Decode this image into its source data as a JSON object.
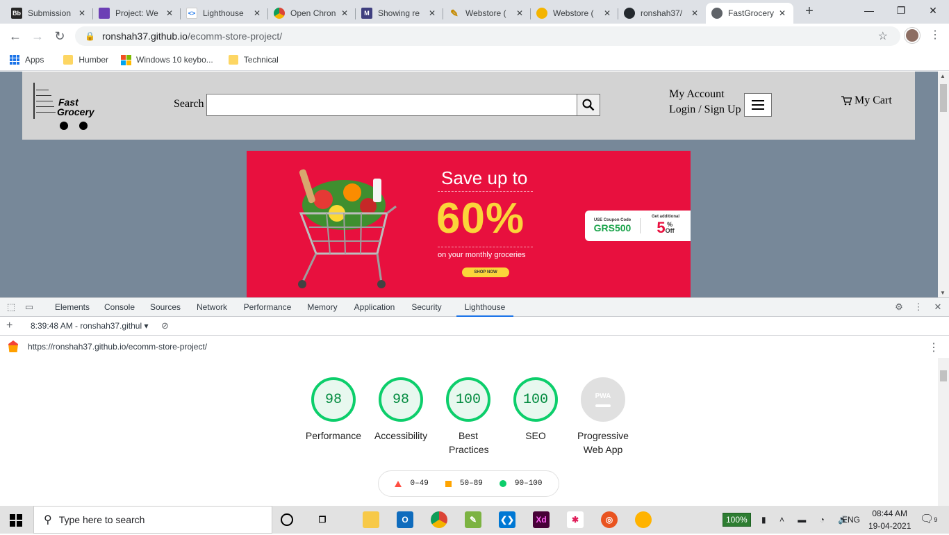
{
  "tabs": [
    {
      "title": "Submission",
      "icon": "blackboard-icon",
      "color": "#262626"
    },
    {
      "title": "Project: We",
      "icon": "project-icon",
      "color": "#6c3fb5"
    },
    {
      "title": "Lighthouse",
      "icon": "lighthouse-icon",
      "color": "#1a73e8"
    },
    {
      "title": "Open Chron",
      "icon": "chrome-icon",
      "color": "#4285f4"
    },
    {
      "title": "Showing re",
      "icon": "m-icon",
      "color": "#3f3f7f"
    },
    {
      "title": "Webstore (",
      "icon": "pencil-icon",
      "color": "#c58a00"
    },
    {
      "title": "Webstore (",
      "icon": "avatar-icon",
      "color": "#f4b400"
    },
    {
      "title": "ronshah37/",
      "icon": "github-icon",
      "color": "#24292e"
    },
    {
      "title": "FastGrocery",
      "icon": "globe-icon",
      "color": "#5f6368"
    }
  ],
  "address": {
    "host": "ronshah37.github.io",
    "path": "/ecomm-store-project/"
  },
  "bookmarks": [
    {
      "label": "Apps"
    },
    {
      "label": "Humber"
    },
    {
      "label": "Windows 10 keybo..."
    },
    {
      "label": "Technical"
    }
  ],
  "site": {
    "logo_line1": "Fast",
    "logo_line2": "Grocery",
    "search_label": "Search",
    "account_line1": "My Account",
    "login": "Login",
    "slash": " / ",
    "signup": "Sign Up",
    "cart": "My Cart"
  },
  "banner": {
    "save": "Save up to",
    "percent": "60%",
    "monthly": "on your monthly groceries",
    "shop": "SHOP NOW",
    "coupon_label": "USE Coupon Code",
    "coupon_code": "GRS500",
    "additional": "Get additional",
    "extra": "5",
    "pct": "%",
    "off": "Off"
  },
  "devtools": {
    "tabs": [
      "Elements",
      "Console",
      "Sources",
      "Network",
      "Performance",
      "Memory",
      "Application",
      "Security",
      "Lighthouse"
    ],
    "active_tab": "Lighthouse",
    "report_time": "8:39:48 AM - ronshah37.githul",
    "report_url": "https://ronshah37.github.io/ecomm-store-project/"
  },
  "lighthouse": {
    "scores": [
      {
        "label": "Performance",
        "score": "98"
      },
      {
        "label": "Accessibility",
        "score": "98"
      },
      {
        "label": "Best Practices",
        "score": "100"
      },
      {
        "label": "SEO",
        "score": "100"
      }
    ],
    "pwa": {
      "label": "Progressive Web App",
      "badge": "PWA"
    },
    "legend": [
      {
        "range": "0–49",
        "color": "#ff4e42"
      },
      {
        "range": "50–89",
        "color": "#ffa400"
      },
      {
        "range": "90–100",
        "color": "#0cce6b"
      }
    ]
  },
  "taskbar": {
    "search_placeholder": "Type here to search",
    "battery": "100%",
    "lang": "ENG",
    "time": "08:44 AM",
    "date": "19-04-2021",
    "notifications": "9"
  }
}
